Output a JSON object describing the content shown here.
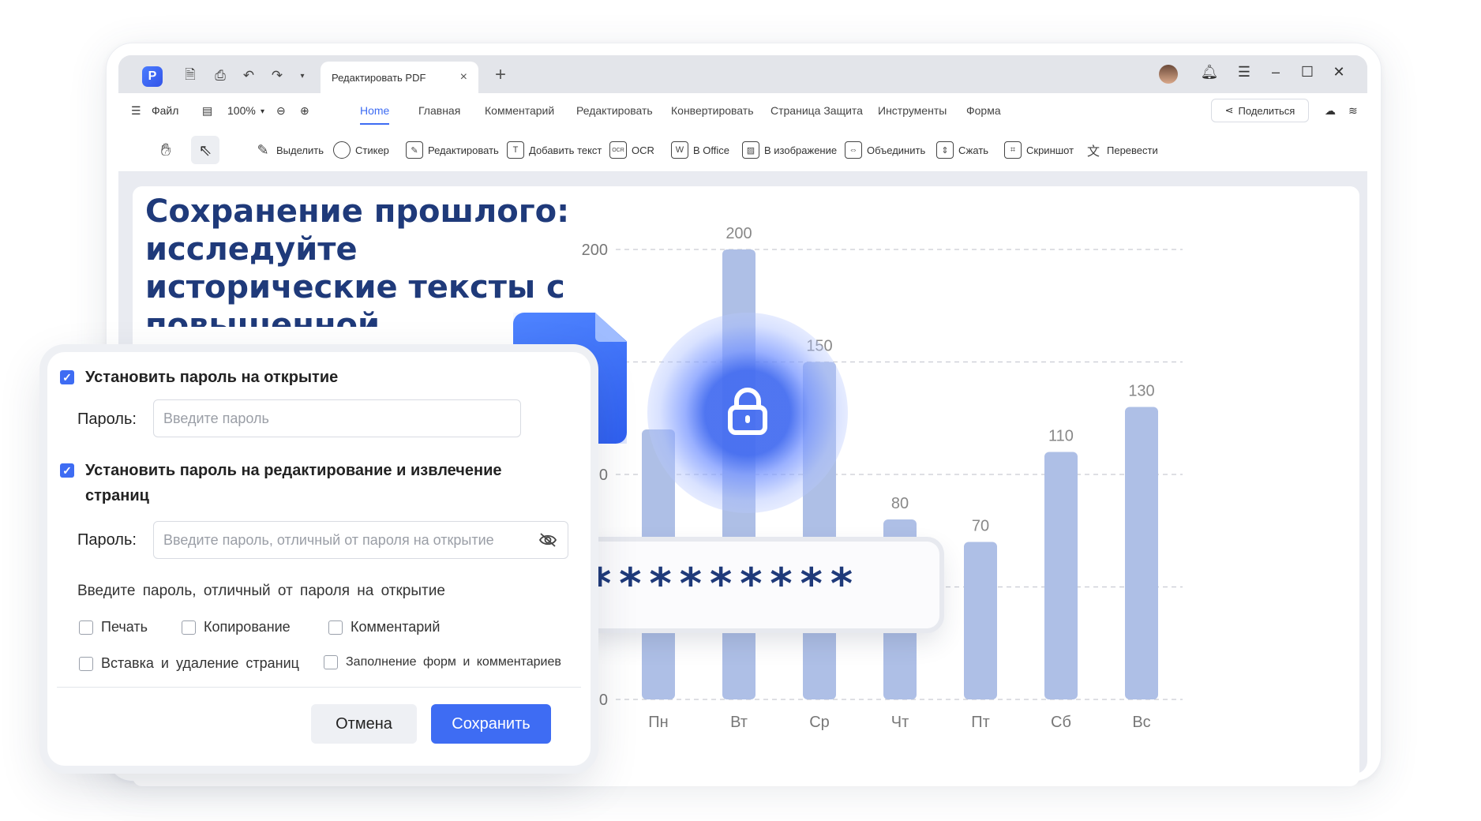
{
  "titlebar": {
    "tab_title": "Редактировать PDF",
    "tab_close": "×",
    "add_tab": "+"
  },
  "menubar": {
    "file_label": "Файл",
    "zoom": "100%",
    "tabs": [
      "Home",
      "Главная",
      "Комментарий",
      "Редактировать",
      "Конвертировать",
      "Страница Защита",
      "Инструменты",
      "Форма"
    ],
    "active_tab": "Home",
    "share_label": "Поделиться"
  },
  "toolbar": {
    "tools": [
      {
        "label": "Выделить",
        "icon": "highlight-icon"
      },
      {
        "label": "Стикер",
        "icon": "sticker-icon"
      },
      {
        "label": "Редактировать",
        "icon": "edit-icon"
      },
      {
        "label": "Добавить текст",
        "icon": "add-text-icon"
      },
      {
        "label": "OCR",
        "icon": "ocr-icon"
      },
      {
        "label": "В Office",
        "icon": "to-office-icon"
      },
      {
        "label": "В изображение",
        "icon": "to-image-icon"
      },
      {
        "label": "Объединить",
        "icon": "merge-icon"
      },
      {
        "label": "Сжать",
        "icon": "compress-icon"
      },
      {
        "label": "Скриншот",
        "icon": "screenshot-icon"
      },
      {
        "label": "Перевести",
        "icon": "translate-icon"
      }
    ]
  },
  "document": {
    "heading": "Сохранение прошлого: исследуйте исторические тексты с повышенной четкостью"
  },
  "chart_data": {
    "type": "bar",
    "categories": [
      "Пн",
      "Вт",
      "Ср",
      "Чт",
      "Пт",
      "Сб",
      "Вс"
    ],
    "values": [
      120,
      200,
      150,
      80,
      70,
      110,
      130
    ],
    "data_labels": [
      "",
      "200",
      "150",
      "80",
      "70",
      "110",
      "130"
    ],
    "ytick_labels": [
      "0",
      "",
      "0",
      "",
      "200"
    ],
    "yticks": [
      0,
      50,
      100,
      150,
      200
    ],
    "ylim": [
      0,
      200
    ],
    "grid": true,
    "bar_color": "#aebfe6"
  },
  "dialog": {
    "open_password_label": "Установить пароль на открытие",
    "open_password_checked": true,
    "password_label": "Пароль:",
    "open_password_placeholder": "Введите пароль",
    "edit_password_label": "Установить пароль на редактирование и извлечение страниц",
    "edit_password_checked": true,
    "edit_password_placeholder": "Введите пароль, отличный от пароля на открытие",
    "hint": "Введите пароль, отличный от пароля на открытие",
    "permissions": [
      {
        "label": "Печать",
        "checked": false
      },
      {
        "label": "Копирование",
        "checked": false
      },
      {
        "label": "Комментарий",
        "checked": false
      },
      {
        "label": "Вставка и удаление страниц",
        "checked": false
      },
      {
        "label": "Заполнение форм и комментариев",
        "checked": false
      }
    ],
    "cancel_label": "Отмена",
    "save_label": "Сохранить"
  },
  "password_display": "*********",
  "colors": {
    "accent": "#3e6cf3",
    "heading": "#1f3a7a",
    "bar": "#aebfe6"
  }
}
